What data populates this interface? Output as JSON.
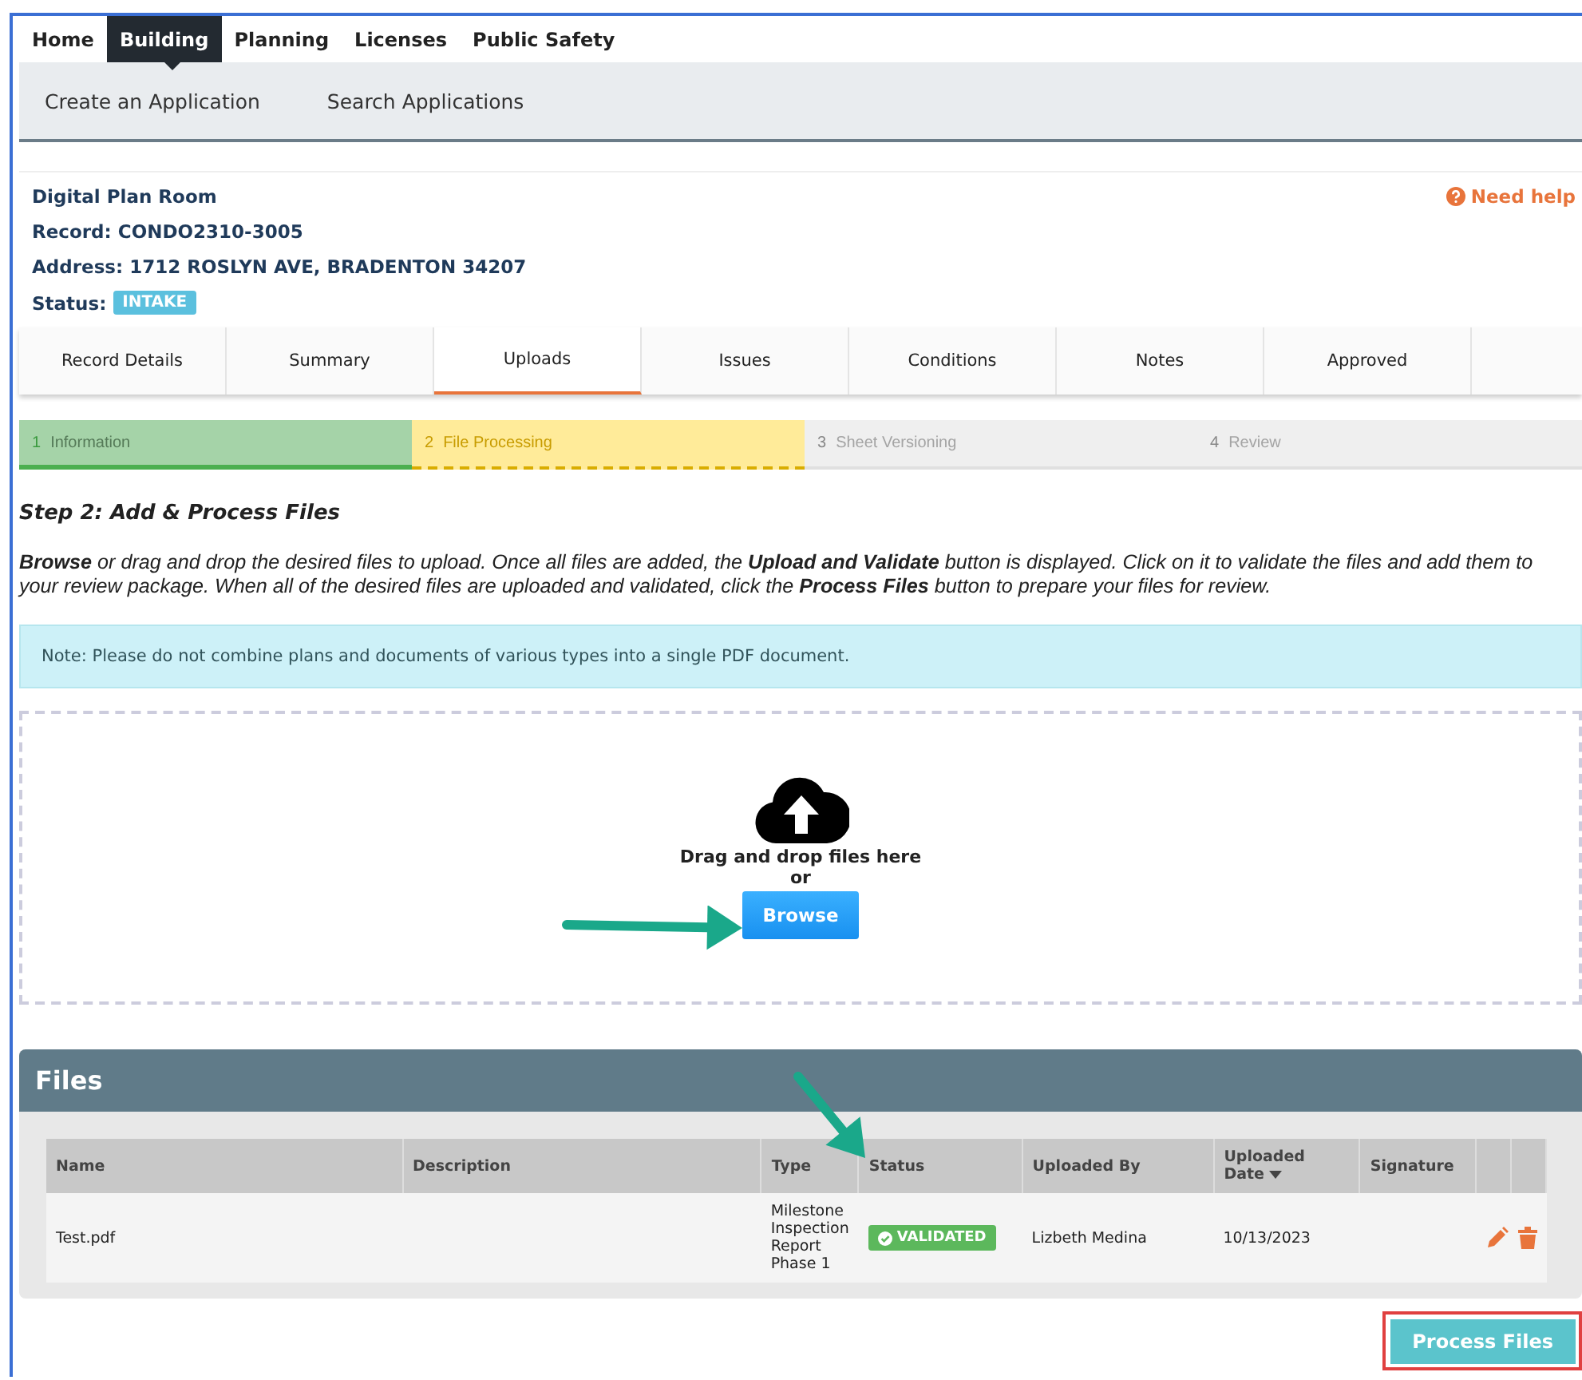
{
  "top_nav": [
    {
      "label": "Home",
      "selected": false
    },
    {
      "label": "Building",
      "selected": true
    },
    {
      "label": "Planning",
      "selected": false
    },
    {
      "label": "Licenses",
      "selected": false
    },
    {
      "label": "Public Safety",
      "selected": false
    }
  ],
  "sub_nav": [
    "Create an Application",
    "Search Applications"
  ],
  "record": {
    "title": "Digital Plan Room",
    "record": "Record: CONDO2310-3005",
    "address": "Address: 1712 ROSLYN AVE, BRADENTON 34207",
    "status_label": "Status:",
    "status": "INTAKE",
    "help": "Need help"
  },
  "tabs": [
    {
      "label": "Record Details",
      "selected": false
    },
    {
      "label": "Summary",
      "selected": false
    },
    {
      "label": "Uploads",
      "selected": true
    },
    {
      "label": "Issues",
      "selected": false
    },
    {
      "label": "Conditions",
      "selected": false
    },
    {
      "label": "Notes",
      "selected": false
    },
    {
      "label": "Approved",
      "selected": false
    }
  ],
  "steps": [
    {
      "number": "1",
      "label": "Information",
      "complete": true,
      "current": false
    },
    {
      "number": "2",
      "label": "File Processing",
      "complete": false,
      "current": true
    },
    {
      "number": "3",
      "label": "Sheet Versioning",
      "complete": false,
      "current": false
    },
    {
      "number": "4",
      "label": "Review",
      "complete": false,
      "current": false
    }
  ],
  "heading": "Step 2: Add & Process Files",
  "instructions": "**Browse** or drag and drop the desired files to upload. Once all files are added, the **Upload and Validate** button is displayed. Click on it to validate the files and add them to your review package. When all of the desired files are uploaded and validated, click the **Process Files** button to prepare your files for review.",
  "note": "Note: Please do not combine plans and documents of various types into a single PDF document.",
  "dropzone": {
    "text": "Drag and drop files here",
    "or": "or",
    "button": "Browse"
  },
  "files": {
    "title": "Files",
    "columns": [
      "Name",
      "Description",
      "Type",
      "Status",
      "Uploaded By",
      "Uploaded Date",
      "Signature"
    ],
    "rows": [
      {
        "name": "Test.pdf",
        "type": "Milestone Inspection Report Phase 1",
        "status": "VALIDATED",
        "uploaded_by": "Lizbeth Medina",
        "uploaded_date": "10/13/2023"
      }
    ]
  },
  "process_button": "Process Files"
}
